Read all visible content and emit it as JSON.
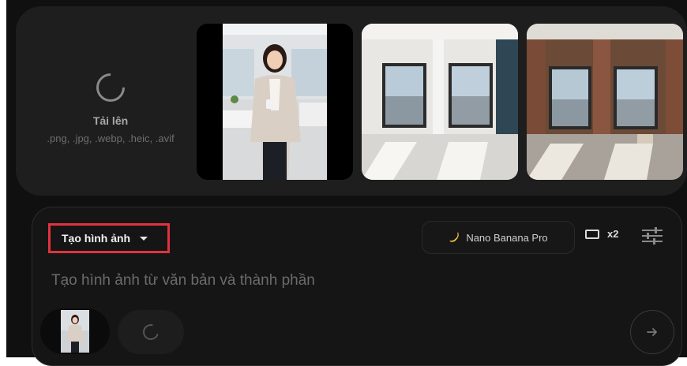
{
  "upload": {
    "title": "Tải lên",
    "formats": ".png, .jpg, .webp, .heic, .avif"
  },
  "gallery": {
    "items": [
      {
        "name": "woman-office-photo"
      },
      {
        "name": "empty-apartment-photo"
      },
      {
        "name": "unfinished-apartment-photo"
      }
    ]
  },
  "prompt": {
    "mode_label": "Tạo hình ảnh",
    "model_label": "Nano Banana Pro",
    "count_label": "x2",
    "placeholder": "Tạo hình ảnh từ văn bản và thành phần"
  },
  "colors": {
    "highlight": "#e0323f",
    "panel": "#1e1e1e",
    "background": "#101010"
  }
}
